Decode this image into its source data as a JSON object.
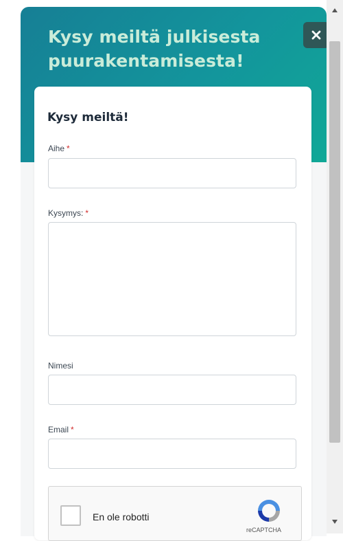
{
  "hero": {
    "title": "Kysy meiltä julkisesta puurakentamisesta!"
  },
  "close_button": {
    "glyph": "✕"
  },
  "form": {
    "title": "Kysy meiltä!",
    "subject": {
      "label": "Aihe",
      "required_mark": "*",
      "value": ""
    },
    "question": {
      "label": "Kysymys:",
      "required_mark": "*",
      "value": ""
    },
    "name": {
      "label": "Nimesi",
      "value": ""
    },
    "email": {
      "label": "Email",
      "required_mark": "*",
      "value": ""
    }
  },
  "captcha": {
    "label": "En ole robotti",
    "brand": "reCAPTCHA"
  },
  "colors": {
    "hero_start": "#167f95",
    "hero_end": "#10a897",
    "hero_text": "#c9ecd9",
    "close_bg": "#2f5757",
    "required": "#d12b2b"
  }
}
